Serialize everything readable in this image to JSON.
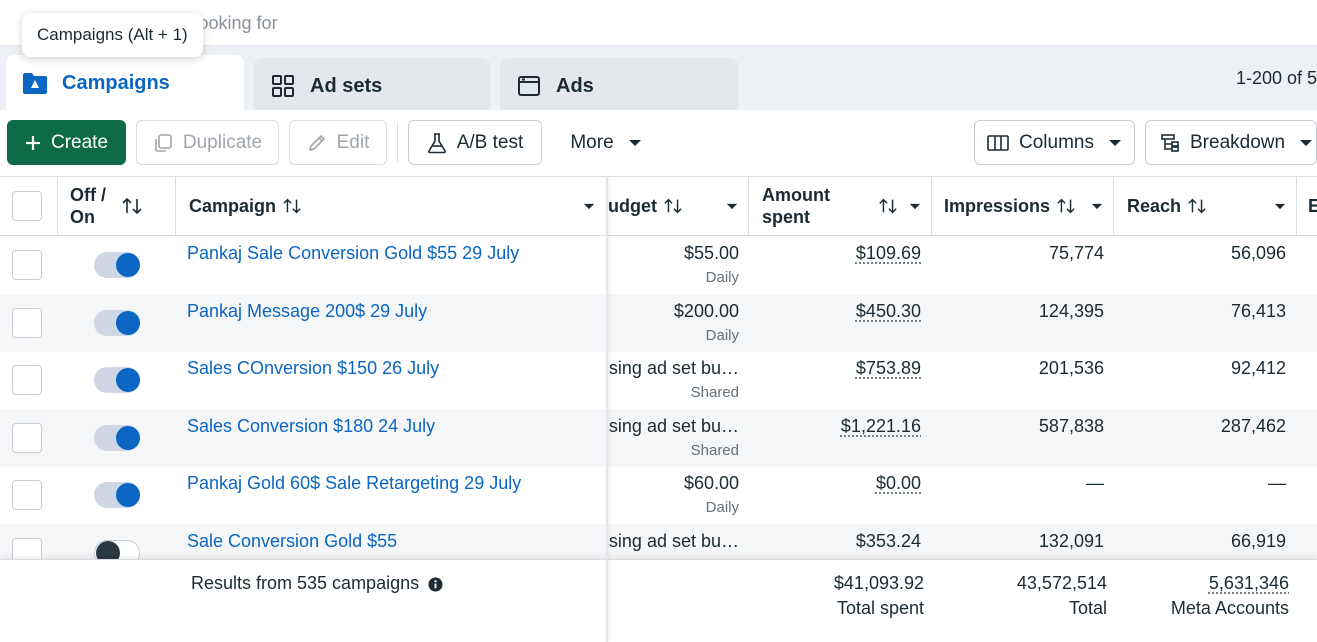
{
  "search": {
    "placeholder": "Describe what you're looking for"
  },
  "tooltip": "Campaigns (Alt + 1)",
  "tabs": [
    {
      "label": "Campaigns",
      "icon": "folder-icon",
      "active": true
    },
    {
      "label": "Ad sets",
      "icon": "grid-icon",
      "active": false
    },
    {
      "label": "Ads",
      "icon": "ad-window-icon",
      "active": false
    }
  ],
  "range_text": "1-200 of 5",
  "toolbar": {
    "create": "Create",
    "duplicate": "Duplicate",
    "edit": "Edit",
    "ab_test": "A/B test",
    "more": "More",
    "columns": "Columns",
    "breakdown": "Breakdown"
  },
  "columns": {
    "off_on": "Off / On",
    "campaign": "Campaign",
    "budget": "udget",
    "amount_spent": "Amount spent",
    "impressions": "Impressions",
    "reach": "Reach",
    "next": "E"
  },
  "rows": [
    {
      "name": "Pankaj Sale Conversion Gold $55 29 July",
      "on": true,
      "budget": "$55.00",
      "budget_sub": "Daily",
      "spent": "$109.69",
      "impressions": "75,774",
      "reach": "56,096"
    },
    {
      "name": "Pankaj Message 200$ 29 July",
      "on": true,
      "budget": "$200.00",
      "budget_sub": "Daily",
      "spent": "$450.30",
      "impressions": "124,395",
      "reach": "76,413"
    },
    {
      "name": "Sales COnversion $150 26 July",
      "on": true,
      "budget": "sing ad set bu…",
      "budget_sub": "Shared",
      "spent": "$753.89",
      "impressions": "201,536",
      "reach": "92,412"
    },
    {
      "name": "Sales Conversion $180 24 July",
      "on": true,
      "budget": "sing ad set bu…",
      "budget_sub": "Shared",
      "spent": "$1,221.16",
      "impressions": "587,838",
      "reach": "287,462"
    },
    {
      "name": "Pankaj Gold 60$ Sale Retargeting 29 July",
      "on": true,
      "budget": "$60.00",
      "budget_sub": "Daily",
      "spent": "$0.00",
      "impressions": "—",
      "reach": "—"
    },
    {
      "name": "Sale Conversion Gold $55",
      "on": false,
      "budget": "sing ad set bu…",
      "budget_sub": "",
      "spent": "$353.24",
      "impressions": "132,091",
      "reach": "66,919"
    }
  ],
  "footer": {
    "results": "Results from 535 campaigns",
    "total_spent": "$41,093.92",
    "total_spent_label": "Total spent",
    "total_impressions": "43,572,514",
    "total_impressions_label": "Total",
    "total_reach": "5,631,346",
    "total_reach_label": "Meta Accounts"
  },
  "colors": {
    "brand_green": "#0e6b47",
    "link_blue": "#0a66c2",
    "toggle_on": "#0a66c2"
  }
}
